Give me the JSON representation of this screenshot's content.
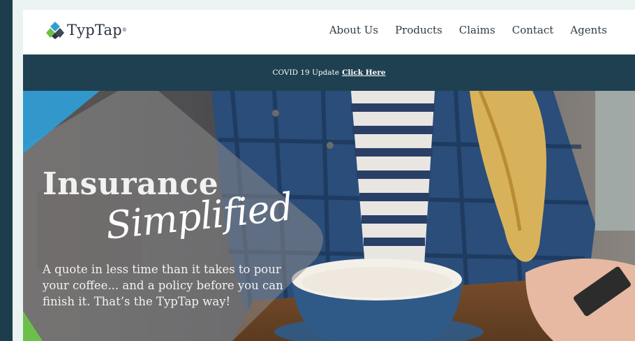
{
  "header": {
    "logo_text": "TypTap",
    "logo_reg": "®",
    "nav": [
      "About Us",
      "Products",
      "Claims",
      "Contact",
      "Agents"
    ]
  },
  "banner": {
    "text": "COVID 19 Update",
    "link": "Click Here"
  },
  "hero": {
    "title": "Insurance",
    "script": "Simplified",
    "copy": "A quote in less time than it takes to pour your coffee... and a policy before you can finish it. That’s the TypTap way!"
  },
  "colors": {
    "banner_bg": "#1f4050",
    "brand_blue": "#2f9ed8",
    "brand_green": "#6cc04a",
    "nav_text": "#2d3c46"
  },
  "icons": {
    "logo": "typtap-logo-icon"
  }
}
